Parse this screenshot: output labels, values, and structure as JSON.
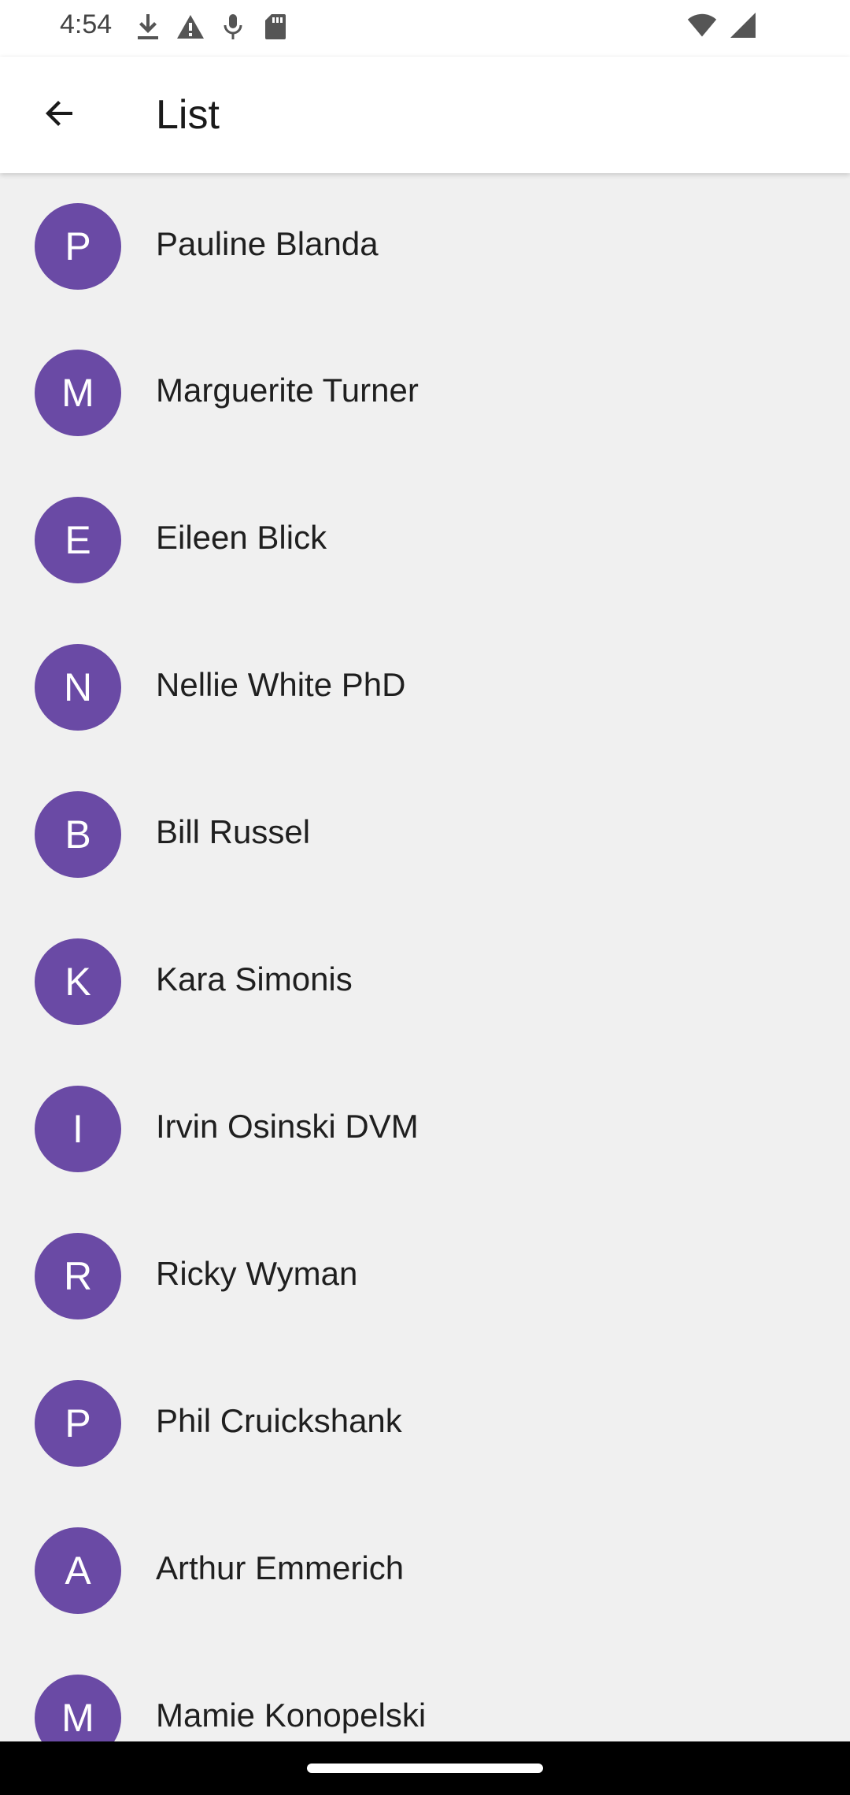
{
  "status_bar": {
    "time": "4:54",
    "left_icons": [
      "download-icon",
      "warning-icon",
      "mic-icon",
      "sd-card-icon"
    ],
    "right_icons": [
      "wifi-icon",
      "signal-icon"
    ]
  },
  "app_bar": {
    "title": "List",
    "back_icon": "arrow-back-icon"
  },
  "colors": {
    "avatar_bg": "#6a4aa5",
    "list_bg": "#f0f0f0",
    "app_bar_bg": "#ffffff"
  },
  "list": {
    "items": [
      {
        "initial": "P",
        "name": "Pauline Blanda"
      },
      {
        "initial": "M",
        "name": "Marguerite Turner"
      },
      {
        "initial": "E",
        "name": "Eileen Blick"
      },
      {
        "initial": "N",
        "name": "Nellie White PhD"
      },
      {
        "initial": "B",
        "name": "Bill Russel"
      },
      {
        "initial": "K",
        "name": "Kara Simonis"
      },
      {
        "initial": "I",
        "name": "Irvin Osinski DVM"
      },
      {
        "initial": "R",
        "name": "Ricky Wyman"
      },
      {
        "initial": "P",
        "name": "Phil Cruickshank"
      },
      {
        "initial": "A",
        "name": "Arthur Emmerich"
      },
      {
        "initial": "M",
        "name": "Mamie Konopelski"
      }
    ]
  }
}
